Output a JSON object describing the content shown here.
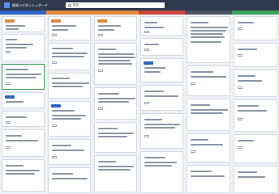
{
  "app": {
    "title": "開発ラボダッシュボード"
  },
  "search": {
    "value": "設定"
  },
  "colors": {
    "topbar": "#2f3a4d",
    "blue": "#2e63c5",
    "orange": "#e3893b",
    "green": "#3aa35a",
    "red": "#c9473f",
    "slate": "#4b5563"
  },
  "columns": [
    {
      "title": "",
      "color": "#2e63c5"
    },
    {
      "title": "",
      "color": "#e3893b"
    },
    {
      "title": "",
      "color": "#e3893b"
    },
    {
      "title": "",
      "color": "#c9473f"
    },
    {
      "title": "",
      "color": "#4b5563"
    },
    {
      "title": "",
      "color": "#3aa35a"
    }
  ]
}
